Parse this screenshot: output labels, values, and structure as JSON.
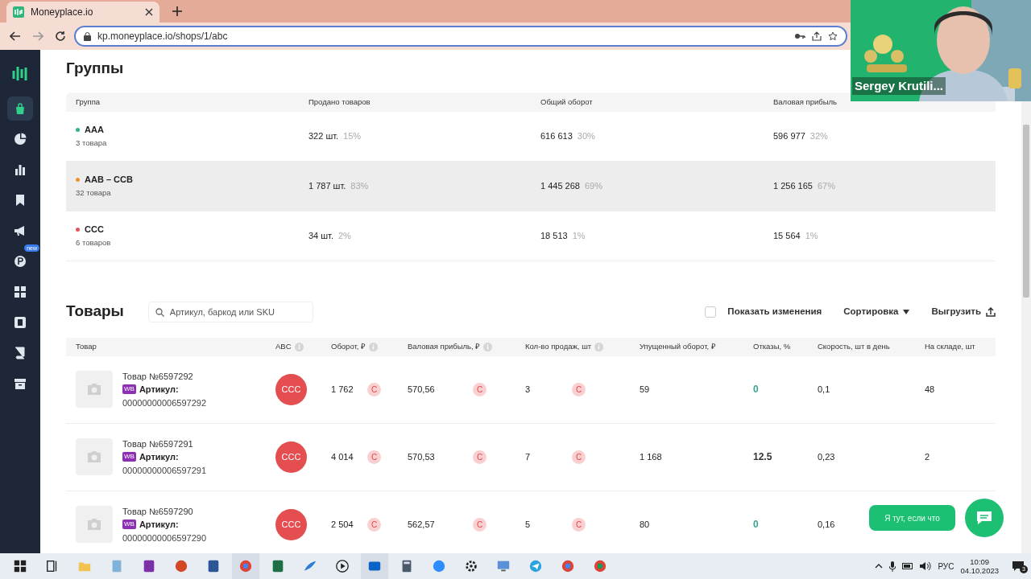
{
  "browser": {
    "tab_title": "Moneyplace.io",
    "url": "kp.moneyplace.io/shops/1/abc"
  },
  "webcam": {
    "name": "Sergey Krutili..."
  },
  "sidebar": {
    "items": [
      {
        "selected": false
      },
      {
        "selected": true
      },
      {
        "selected": false
      },
      {
        "selected": false
      },
      {
        "selected": false
      },
      {
        "selected": false
      },
      {
        "selected": false,
        "badge": "new"
      },
      {
        "selected": false
      },
      {
        "selected": false
      },
      {
        "selected": false
      },
      {
        "selected": false
      }
    ]
  },
  "groups": {
    "title": "Группы",
    "columns": [
      "Группа",
      "Продано товаров",
      "Общий оборот",
      "Валовая прибыль"
    ],
    "rows": [
      {
        "name": "AAA",
        "count": "3 товара",
        "color": "#2fb67c",
        "highlighted": false,
        "sold": {
          "value": "322 шт.",
          "share": "15%"
        },
        "turnover": {
          "value": "616 613",
          "share": "30%"
        },
        "profit": {
          "value": "596 977",
          "share": "32%"
        }
      },
      {
        "name": "AAB – CCB",
        "count": "32 товара",
        "color": "#f0922b",
        "highlighted": true,
        "sold": {
          "value": "1 787 шт.",
          "share": "83%"
        },
        "turnover": {
          "value": "1 445 268",
          "share": "69%"
        },
        "profit": {
          "value": "1 256 165",
          "share": "67%"
        }
      },
      {
        "name": "CCC",
        "count": "6 товаров",
        "color": "#e5525b",
        "highlighted": false,
        "sold": {
          "value": "34 шт.",
          "share": "2%"
        },
        "turnover": {
          "value": "18 513",
          "share": "1%"
        },
        "profit": {
          "value": "15 564",
          "share": "1%"
        }
      }
    ]
  },
  "products": {
    "title": "Товары",
    "search": {
      "placeholder": "Артикул, баркод или SKU"
    },
    "show_changes": {
      "label": "Показать изменения",
      "checked": false
    },
    "sort": "Сортировка",
    "export": "Выгрузить",
    "columns": [
      {
        "label": "Товар",
        "info": false
      },
      {
        "label": "ABC",
        "info": true
      },
      {
        "label": "Оборот, ₽",
        "info": true
      },
      {
        "label": "Валовая прибыль, ₽",
        "info": true
      },
      {
        "label": "Кол-во продаж, шт",
        "info": true
      },
      {
        "label": "Упущенный оборот, ₽",
        "info": false
      },
      {
        "label": "Отказы, %",
        "info": false
      },
      {
        "label": "Скорость, шт в день",
        "info": false
      },
      {
        "label": "На складе, шт",
        "info": false
      }
    ],
    "rows": [
      {
        "name": "Товар №6597292",
        "marketplace": "WB",
        "article_label": "Артикул:",
        "article": "00000000006597292",
        "abc": "CCC",
        "turnover": {
          "value": "1 762",
          "grade": "C"
        },
        "profit": {
          "value": "570,56",
          "grade": "C"
        },
        "sales": {
          "value": "3",
          "grade": "C"
        },
        "lost": "59",
        "refusals": {
          "value": "0",
          "color": "#3aa58f"
        },
        "speed": "0,1",
        "stock": "48"
      },
      {
        "name": "Товар №6597291",
        "marketplace": "WB",
        "article_label": "Артикул:",
        "article": "00000000006597291",
        "abc": "CCC",
        "turnover": {
          "value": "4 014",
          "grade": "C"
        },
        "profit": {
          "value": "570,53",
          "grade": "C"
        },
        "sales": {
          "value": "7",
          "grade": "C"
        },
        "lost": "1 168",
        "refusals": {
          "value": "12.5",
          "color": "#333333"
        },
        "speed": "0,23",
        "stock": "2"
      },
      {
        "name": "Товар №6597290",
        "marketplace": "WB",
        "article_label": "Артикул:",
        "article": "00000000006597290",
        "abc": "CCC",
        "turnover": {
          "value": "2 504",
          "grade": "C"
        },
        "profit": {
          "value": "562,57",
          "grade": "C"
        },
        "sales": {
          "value": "5",
          "grade": "C"
        },
        "lost": "80",
        "refusals": {
          "value": "0",
          "color": "#3aa58f"
        },
        "speed": "0,16"
      }
    ]
  },
  "chat": {
    "button": "Я тут, если что"
  },
  "taskbar": {
    "language": "РУС",
    "time": "10:09",
    "date": "04.10.2023",
    "notifications": "3"
  }
}
